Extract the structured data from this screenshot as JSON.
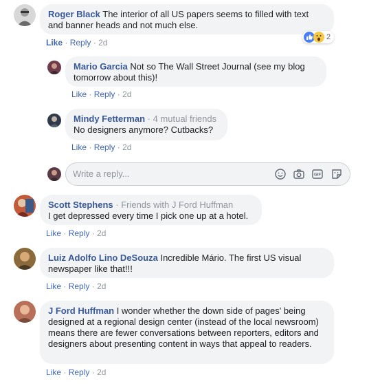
{
  "comments": [
    {
      "author": "Roger Black",
      "text": "The interior of all US papers seems to filled with text and banner heads and not much else.",
      "actions": {
        "like": "Like",
        "reply": "Reply",
        "time": "2d"
      },
      "reactions": {
        "count": "2"
      },
      "replies": [
        {
          "author": "Mario Garcia",
          "text": "Not so The Wall Street Journal (see my blog tomorrow about this)!",
          "actions": {
            "like": "Like",
            "reply": "Reply",
            "time": "2d"
          }
        },
        {
          "author": "Mindy Fetterman",
          "meta": "· 4 mutual friends",
          "text": "No designers anymore? Cutbacks?",
          "actions": {
            "like": "Like",
            "reply": "Reply",
            "time": "2d"
          }
        }
      ],
      "reply_box": {
        "placeholder": "Write a reply..."
      }
    },
    {
      "author": "Scott Stephens",
      "meta": "· Friends with J Ford Huffman",
      "text": "I get depressed every time I pick one up at a hotel.",
      "actions": {
        "like": "Like",
        "reply": "Reply",
        "time": "2d"
      }
    },
    {
      "author": "Luiz Adolfo Lino DeSouza",
      "text": "Incredible Mário. The first US visual newspaper like that!!!",
      "actions": {
        "like": "Like",
        "reply": "Reply",
        "time": "2d"
      }
    },
    {
      "author": "J Ford Huffman",
      "text": "I wonder whether the down side of pages' being designed at a regional design center (instead of the local newsroom) means there are fewer conversations between reporters, editors and designers about presenting content in ways that appeal to readers.",
      "actions": {
        "like": "Like",
        "reply": "Reply",
        "time": "2d"
      }
    }
  ],
  "separator": "·",
  "colors": {
    "link": "#385898",
    "action": "#4267b2",
    "muted": "#90949c",
    "bubble": "#f2f3f5"
  }
}
